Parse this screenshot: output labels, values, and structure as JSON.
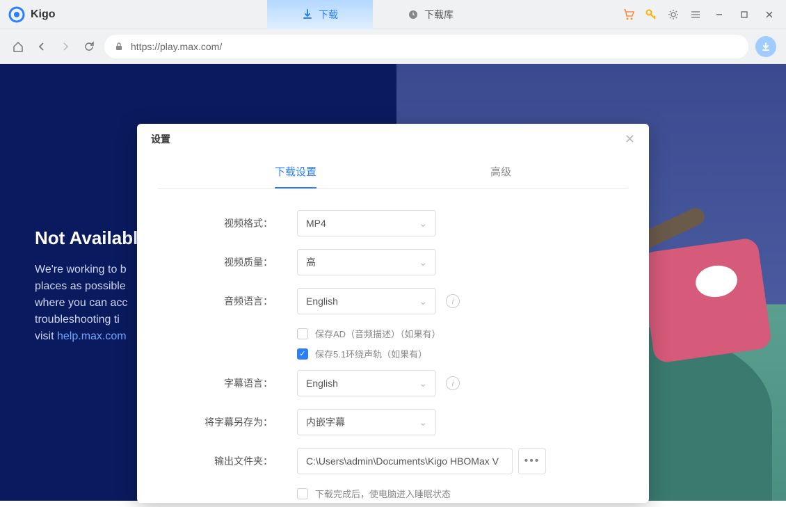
{
  "app": {
    "name": "Kigo"
  },
  "tabs": {
    "download": "下载",
    "library": "下载库"
  },
  "url": "https://play.max.com/",
  "bg": {
    "title": "Not Available",
    "body1": "We're working to b",
    "body2": "places as possible",
    "body3": "where you can acc",
    "body4": "troubleshooting ti",
    "body5_prefix": "visit ",
    "link": "help.max.com"
  },
  "modal": {
    "title": "设置",
    "tab_download": "下载设置",
    "tab_advanced": "高级",
    "labels": {
      "video_format": "视频格式：",
      "video_quality": "视频质量：",
      "audio_lang": "音频语言：",
      "subtitle_lang": "字幕语言：",
      "save_subtitle_as": "将字幕另存为：",
      "output_folder": "输出文件夹："
    },
    "values": {
      "video_format": "MP4",
      "video_quality": "高",
      "audio_lang": "English",
      "subtitle_lang": "English",
      "save_subtitle_as": "内嵌字幕",
      "output_folder": "C:\\Users\\admin\\Documents\\Kigo HBOMax V"
    },
    "checks": {
      "save_ad": "保存AD（音频描述）（如果有）",
      "save_51": "保存5.1环绕声轨（如果有）",
      "sleep_after": "下载完成后，使电脑进入睡眠状态"
    }
  }
}
